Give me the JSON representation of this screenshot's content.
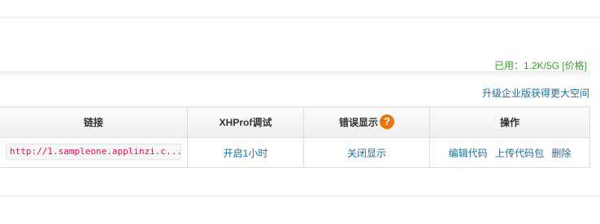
{
  "usage": {
    "label": "已用：1.2K/5G",
    "price_link": "[价格]"
  },
  "upgrade_link": "升级企业版获得更大空间",
  "table": {
    "headers": {
      "link": "链接",
      "xhprof": "XHProf调试",
      "error_display": "错误显示",
      "help_icon": "?",
      "ops": "操作"
    },
    "row": {
      "url": "http://1.sampleone.applinzi.c...",
      "xhprof_action": "开启1小时",
      "error_action": "关闭显示",
      "edit_code": "编辑代码",
      "upload_code": "上传代码包",
      "delete": "删除"
    }
  },
  "colors": {
    "usage_green": "#3c9a2e",
    "link_blue": "#1d6f9a",
    "help_orange": "#e8760e",
    "url_red": "#dd1144"
  }
}
